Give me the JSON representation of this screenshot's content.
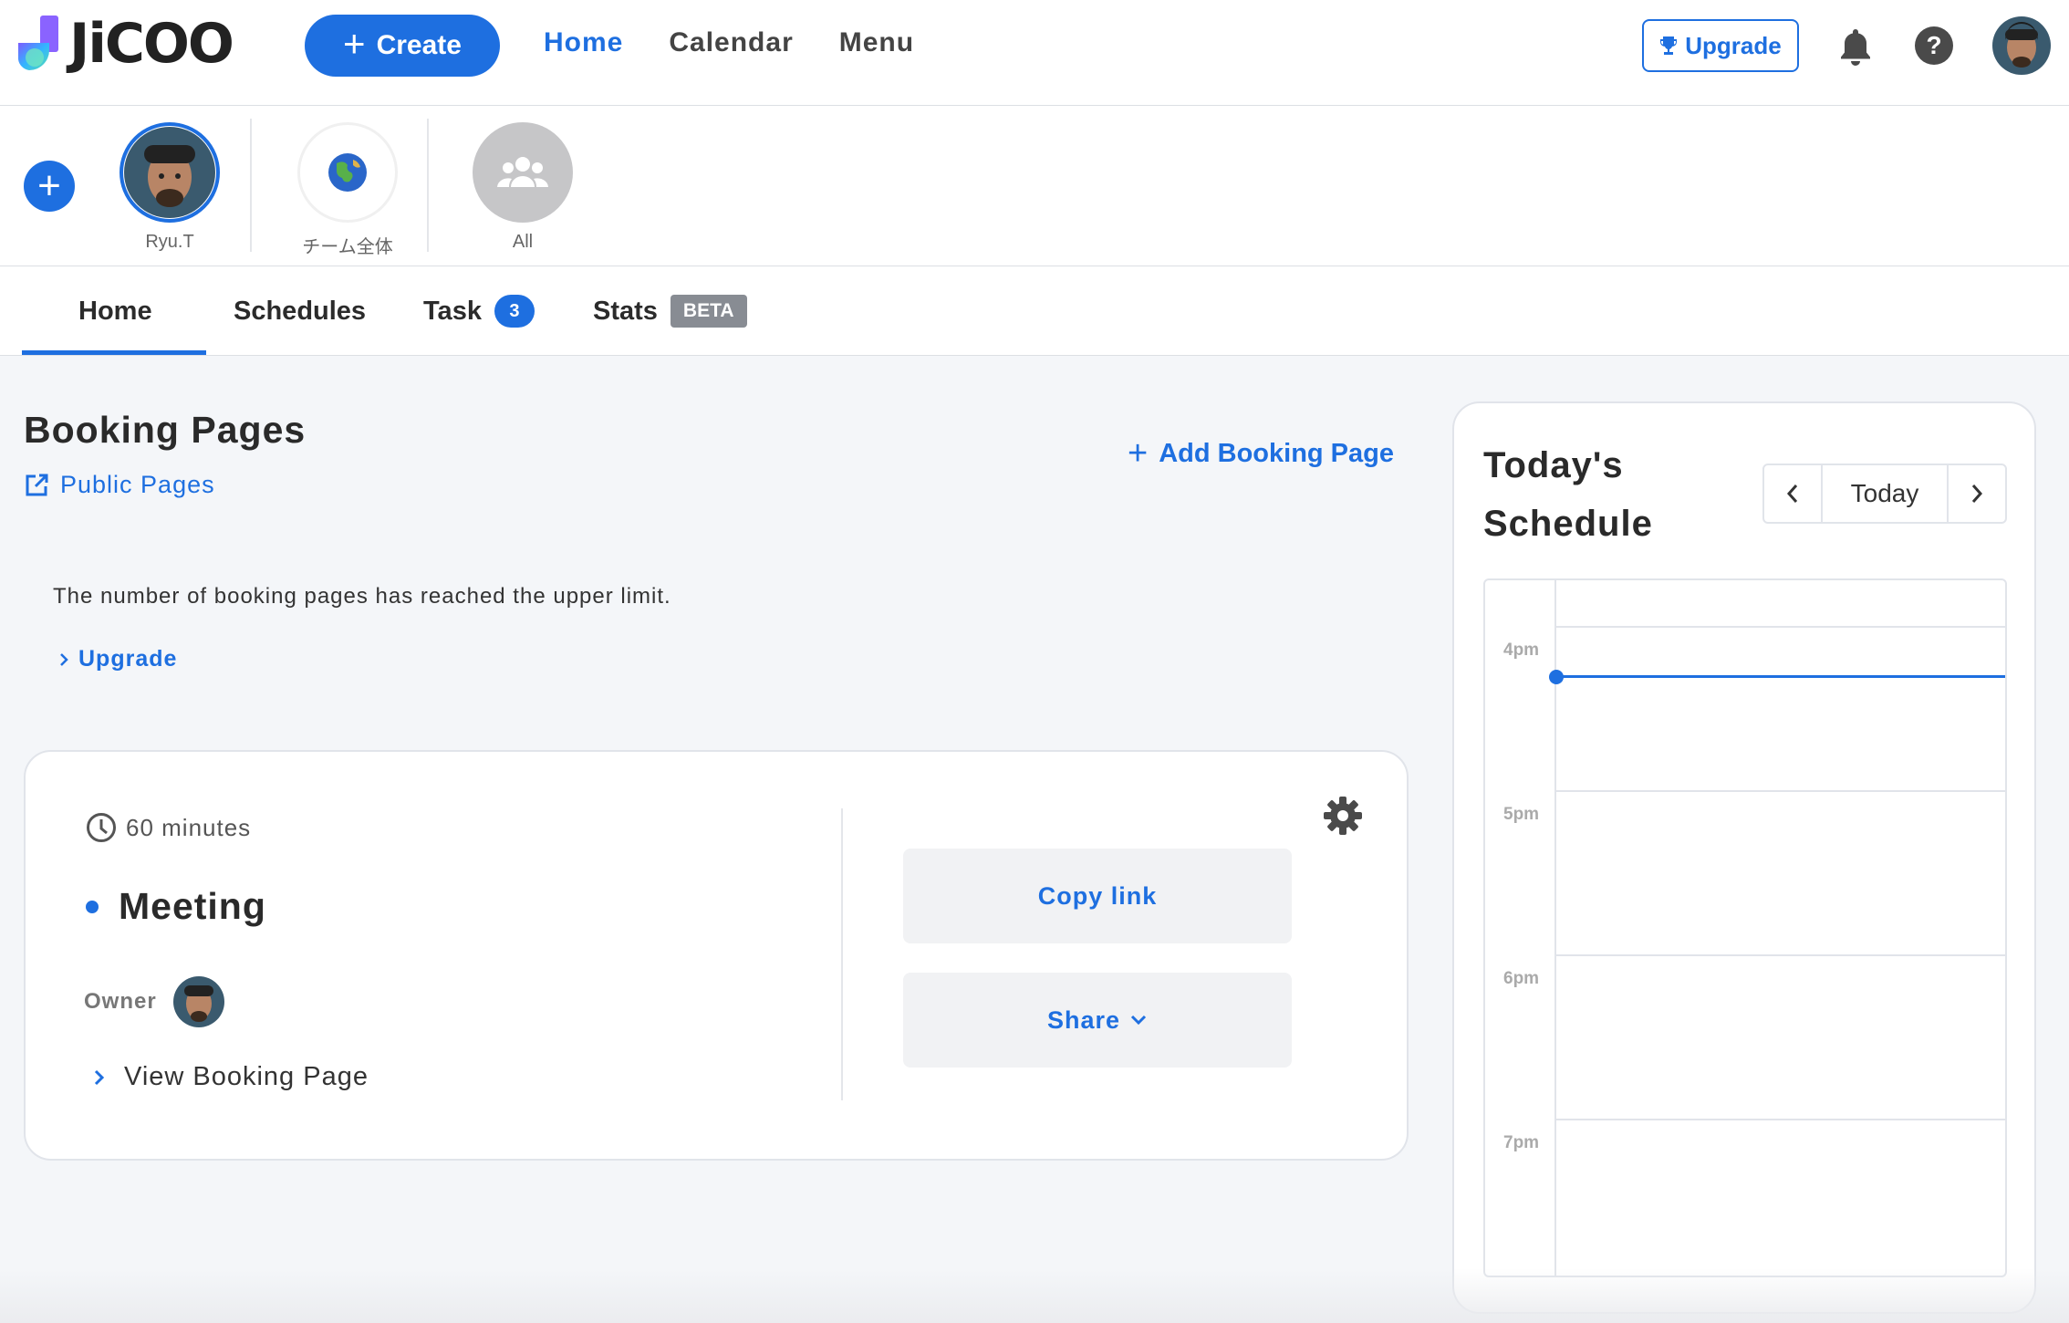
{
  "header": {
    "logo_text": "JiCOO",
    "create_label": "Create",
    "nav": [
      {
        "label": "Home",
        "active": true
      },
      {
        "label": "Calendar",
        "active": false
      },
      {
        "label": "Menu",
        "active": false
      }
    ],
    "upgrade_label": "Upgrade",
    "icons": [
      "trophy-icon",
      "bell-icon",
      "help-icon"
    ],
    "accent_color": "#1e6fe0"
  },
  "members": [
    {
      "label": "Ryu.T",
      "selected": true
    },
    {
      "label": "チーム全体",
      "selected": false
    },
    {
      "label": "All",
      "selected": false
    }
  ],
  "tabs": [
    {
      "label": "Home",
      "active": true
    },
    {
      "label": "Schedules"
    },
    {
      "label": "Task",
      "badge": "3"
    },
    {
      "label": "Stats",
      "badge": "BETA"
    }
  ],
  "booking": {
    "title": "Booking Pages",
    "public_pages_label": "Public Pages",
    "add_label": "Add Booking Page",
    "limit_message": "The number of booking pages has reached the upper limit.",
    "upgrade_link": "Upgrade",
    "card": {
      "duration": "60 minutes",
      "name": "Meeting",
      "owner_label": "Owner",
      "view_label": "View Booking Page",
      "copy_label": "Copy link",
      "share_label": "Share"
    }
  },
  "schedule": {
    "title": "Today's Schedule",
    "today_label": "Today",
    "hours": [
      "4pm",
      "5pm",
      "6pm",
      "7pm"
    ]
  }
}
